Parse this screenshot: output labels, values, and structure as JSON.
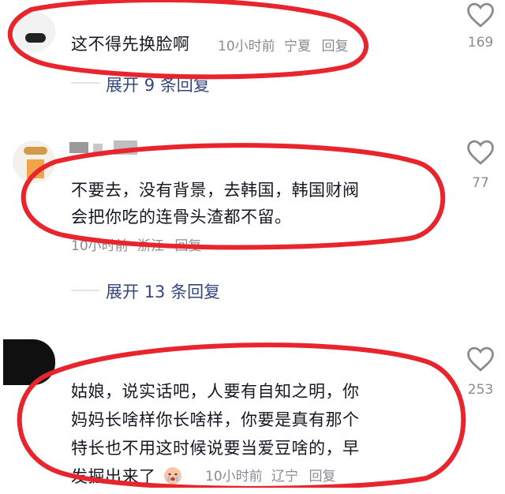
{
  "comments": [
    {
      "text_lines": [
        "这不得先换脸啊"
      ],
      "meta": {
        "time": "10小时前",
        "location": "宁夏",
        "reply": "回复"
      },
      "likes": "169",
      "expand": {
        "prefix": "展开",
        "count": "9",
        "suffix": "条回复"
      }
    },
    {
      "text_lines": [
        "不要去，没有背景，去韩国，韩国财阀",
        "会把你吃的连骨头渣都不留。"
      ],
      "meta": {
        "time": "10小时前",
        "location": "浙江",
        "reply": "回复"
      },
      "likes": "77",
      "expand": {
        "prefix": "展开",
        "count": "13",
        "suffix": "条回复"
      }
    },
    {
      "text_lines": [
        "姑娘，说实话吧，人要有自知之明，你",
        "妈妈长啥样你长啥样，你要是真有那个",
        "特长也不用这时候说要当爱豆啥的，早",
        "发掘出来了"
      ],
      "meta": {
        "time": "10小时前",
        "location": "辽宁",
        "reply": "回复"
      },
      "likes": "253"
    }
  ],
  "icons": {
    "like": "heart-outline-icon",
    "emoji": "crying-face-emoji-icon"
  },
  "colors": {
    "annotation": "#e8242c",
    "link": "#33477e",
    "meta": "#8a8b91",
    "text": "#161823"
  }
}
